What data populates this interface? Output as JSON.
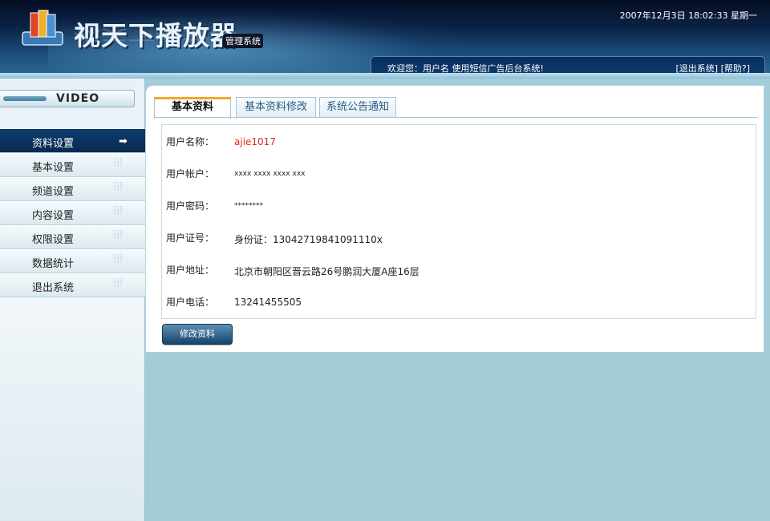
{
  "header": {
    "logo_text": "视天下播放器",
    "badge": "管理系统",
    "datetime": "2007年12月3日 18:02:33 星期一",
    "welcome": "欢迎您：用户名 使用短信广告后台系统!",
    "logout_link": "[退出系统]",
    "help_link": "[帮助?]"
  },
  "sidebar": {
    "title": "VIDEO",
    "items": [
      {
        "label": "资料设置"
      },
      {
        "label": "基本设置"
      },
      {
        "label": "频道设置"
      },
      {
        "label": "内容设置"
      },
      {
        "label": "权限设置"
      },
      {
        "label": "数据统计"
      },
      {
        "label": "退出系统"
      }
    ]
  },
  "tabs": [
    {
      "label": "基本资料"
    },
    {
      "label": "基本资料修改"
    },
    {
      "label": "系统公告通知"
    }
  ],
  "profile": {
    "rows": [
      {
        "key": "用户名称：",
        "value": "ajie1017"
      },
      {
        "key": "用户帐户：",
        "value": "xxxx xxxx xxxx xxx"
      },
      {
        "key": "用户密码：",
        "value": "********"
      },
      {
        "key": "用户证号：",
        "value": "身份证：13042719841091110x"
      },
      {
        "key": "用户地址：",
        "value": "北京市朝阳区晋云路26号鹏润大厦A座16层"
      },
      {
        "key": "用户电话：",
        "value": "13241455505"
      }
    ]
  },
  "edit_button": "修改资料",
  "colors": {
    "active_menu": "#0c3d6e",
    "tab_accent": "#f2a823",
    "username": "#e0261d"
  }
}
